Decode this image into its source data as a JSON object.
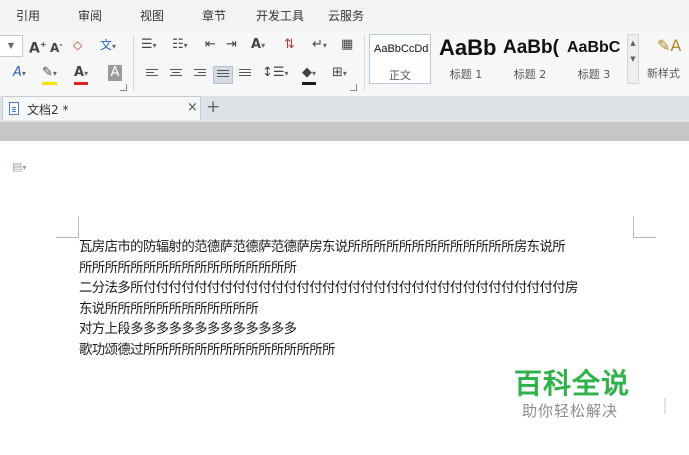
{
  "menu": {
    "items": [
      "引用",
      "审阅",
      "视图",
      "章节",
      "开发工具",
      "云服务"
    ]
  },
  "ribbon": {
    "font_size_combo_value": "",
    "styles": [
      {
        "sample": "AaBbCcDd",
        "name": "正文"
      },
      {
        "sample": "AaBb",
        "name": "标题 1"
      },
      {
        "sample": "AaBb(",
        "name": "标题 2"
      },
      {
        "sample": "AaBbC",
        "name": "标题 3"
      }
    ],
    "new_style_label": "新样式"
  },
  "tabs": {
    "active_label": "文档2 *",
    "close_glyph": "×",
    "new_tab_glyph": "+"
  },
  "document": {
    "lines": [
      "瓦房店市的防辐射的范德萨范德萨范德萨房东说所所所所所所所所所所所所所房东说所",
      "所所所所所所所所所所所所所所所所所",
      "二分法多所付付付付付付付付付付付付付付付付付付付付付付付付付付付付付付付付付房",
      "东说所所所所所所所所所所所所",
      "对方上段多多多多多多多多多多多多多",
      "歌功颂德过所所所所所所所所所所所所所所所"
    ]
  },
  "watermark": {
    "title": "百科全说",
    "subtitle": "助你轻松解决"
  },
  "colors": {
    "watermark_green": "#2fb24a",
    "selected_align_bg": "#d5dbe5"
  }
}
